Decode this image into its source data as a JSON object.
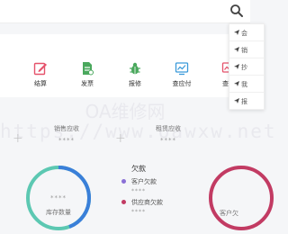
{
  "topbar": {
    "search_icon": "search-icon"
  },
  "dropdown": {
    "items": [
      {
        "label": "会",
        "icon": "send-icon"
      },
      {
        "label": "销",
        "icon": "send-icon"
      },
      {
        "label": "抄",
        "icon": "send-icon"
      },
      {
        "label": "我",
        "icon": "send-icon"
      },
      {
        "label": "报",
        "icon": "send-icon"
      }
    ]
  },
  "actions": [
    {
      "label": "结算",
      "icon": "edit-icon",
      "color": "#e5526b"
    },
    {
      "label": "发票",
      "icon": "invoice-icon",
      "color": "#4aa85d"
    },
    {
      "label": "报修",
      "icon": "bug-icon",
      "color": "#4aa85d"
    },
    {
      "label": "查应付",
      "icon": "chart-icon",
      "color": "#3a9ad9"
    },
    {
      "label": "查应",
      "icon": "chart-icon",
      "color": "#e5526b"
    }
  ],
  "stats": {
    "sales_receivable": {
      "label": "销售应收",
      "value": "****"
    },
    "rental_receivable": {
      "label": "租赁应收",
      "value": "****"
    }
  },
  "inventory": {
    "value": "****",
    "label": "库存数量"
  },
  "debt": {
    "title": "欠款",
    "items": [
      {
        "label": "客户欠款",
        "value": "****",
        "color": "#8a6fd6"
      },
      {
        "label": "供应商欠款",
        "value": "****",
        "color": "#c23b63"
      }
    ]
  },
  "customer_ring": {
    "label": "客户欠"
  },
  "watermark": {
    "cn": "OA维修网",
    "url": "https://www.oawxw.net"
  },
  "colors": {
    "ring_teal": "#5cc8b2",
    "ring_blue": "#3a7fd9",
    "ring_red": "#c23b63"
  }
}
